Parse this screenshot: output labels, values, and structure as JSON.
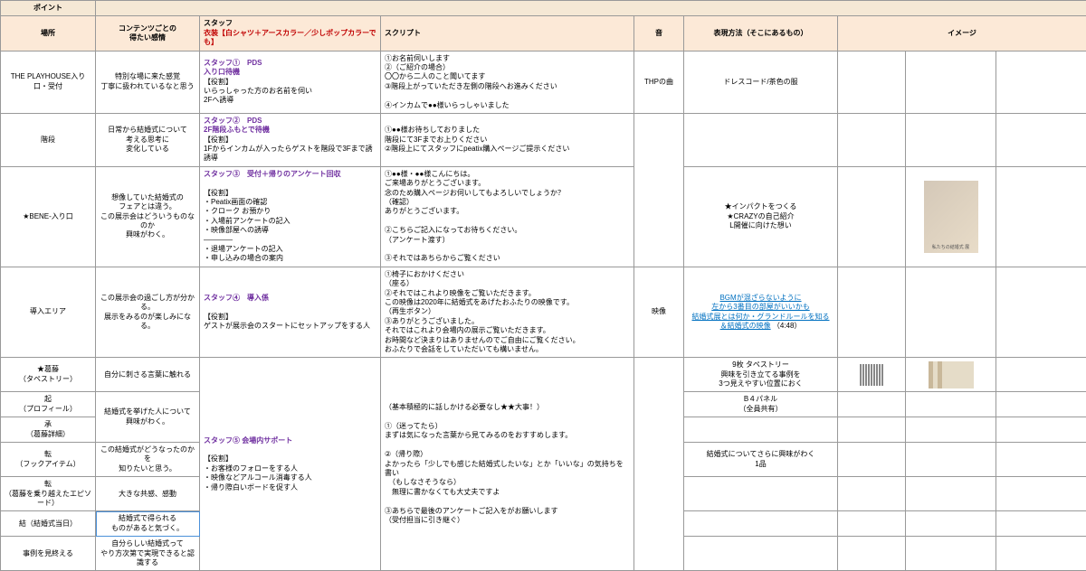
{
  "header": {
    "point": "ポイント",
    "place": "場所",
    "feeling": "コンテンツごとの\n得たい感情",
    "staff_label": "スタッフ",
    "staff_costume": "衣装【白シャツ＋アースカラー／少しポップカラーでも】",
    "script": "スクリプト",
    "sound": "音",
    "expression": "表現方法（そこにあるもの）",
    "image": "イメージ"
  },
  "rows": [
    {
      "place": "THE PLAYHOUSE入り口・受付",
      "feeling": "特別な場に来た感覚\n丁寧に扱われているなと思う",
      "staff_title": "スタッフ①　PDS\n入り口待機",
      "staff_role": "【役割】\nいらっしゃった方のお名前を伺い\n2Fへ誘導",
      "script": "①お名前伺いします\n②（ご紹介の場合）\n〇〇から二人のこと聞いてます\n③階段上がっていただき左側の階段へお進みください\n\n④インカムで●●様いらっしゃいました",
      "sound": "THPの曲",
      "expr": "ドレスコード/茶色の服"
    },
    {
      "place": "階段",
      "feeling": "日常から結婚式について\n考える思考に\n変化している",
      "staff_title": "スタッフ②　PDS\n2F階段ふもとで待機",
      "staff_role": "【役割】\n1Fからインカムが入ったらゲストを階段で3Fまで誘誘導",
      "script": "①●●様お待ちしておりました\n階段にて3Fまでお上りください\n②階段上にてスタッフにpeatix購入ページご提示ください"
    },
    {
      "place": "★BENE-入り口",
      "feeling": "想像していた結婚式の\nフェアとは違う。\nこの展示会はどういうものなのか\n興味がわく。",
      "staff_title": "スタッフ③　受付＋帰りのアンケート回収",
      "staff_role": "【役割】\n・Peatix画面の確認\n・クローク お預かり\n・入場前アンケートの記入\n・映像部屋への誘導\n————\n・退場アンケートの記入\n・申し込みの場合の案内",
      "script": "①●●様・●●様こんにちは。\nご来場ありがとうございます。\n念のため購入ページお伺いしてもよろしいでしょうか？\n（確認）\nありがとうございます。\n\n②こちらご記入になってお待ちください。\n（アンケート渡す）\n\n③それではあちらからご覧ください",
      "expr": "★インパクトをつくる\n★CRAZYの自己紹介\nL開催に向けた想い",
      "has_img": true
    },
    {
      "place": "導入エリア",
      "feeling": "この展示会の過ごし方が分かる。\n展示をみるのが楽しみになる。",
      "staff_title": "スタッフ④　導入係",
      "staff_role": "【役割】\nゲストが展示会のスタートにセットアップをする人",
      "script": "①椅子におかけください\n（座る）\n②それではこれより映像をご覧いただきます。\nこの映像は2020年に結婚式をあげたおふたりの映像です。\n（再生ボタン）\n③ありがとうございました。\nそれではこれより会場内の展示ご覧いただきます。\nお時間など決まりはありませんのでご自由にご覧ください。\nおふたりで会話をしていただいても構いません。",
      "sound": "映像",
      "expr_link1": "BGMが混ざらないように\n左から3番目の部屋がいいかも",
      "expr_link2": "結婚式展とは何か・グランドルールを知る\n＆結婚式の映像",
      "expr_time": "（4:48）"
    },
    {
      "place": "★葛藤\n（タペストリー）",
      "feeling": "自分に刺さる言葉に触れる",
      "expr": "9枚 タペストリー\n興味を引き立てる事例を\n3つ見えやすい位置におく",
      "has_stripes": true
    },
    {
      "place": "起\n（プロフィール）",
      "feeling_rowspan_start": true,
      "feeling": "結婚式を挙げた人について\n興味がわく。",
      "expr": "B４パネル\n（全員共有）"
    },
    {
      "place": "承\n（葛藤詳細）",
      "staff_big_title": "スタッフ⑤ 会場内サポート",
      "staff_big_role": "【役割】\n・お客様のフォローをする人\n・映像などアルコール消毒する人\n・帰り際白いボードを促す人",
      "script_big": "（基本積極的に話しかける必要なし★★大事！）\n\n①（迷ってたら）\nまずは気になった言葉から見てみるのをおすすめします。\n\n②（帰り際）\nよかったら「少しでも感じた結婚式したいな」とか「いいな」の気持ちを書い\n　（もしなさそうなら）\n　無理に書かなくても大丈夫ですよ\n\n③あちらで最後のアンケートご記入をがお願いします\n（受付担当に引き継ぐ）"
    },
    {
      "place": "転\n（フックアイテム）",
      "feeling": "この結婚式がどうなったのかを\n知りたいと思う。",
      "expr": "結婚式についてさらに興味がわく\n1品"
    },
    {
      "place": "転\n（葛藤を乗り越えたエピソード）",
      "feeling": "大きな共感、感動"
    },
    {
      "place": "結（結婚式当日）",
      "feeling": "結婚式で得られる\nものがあると気づく。"
    },
    {
      "place": "事例を見終える",
      "feeling": "自分らしい結婚式って\nやり方次第で実現できると認識する"
    }
  ]
}
